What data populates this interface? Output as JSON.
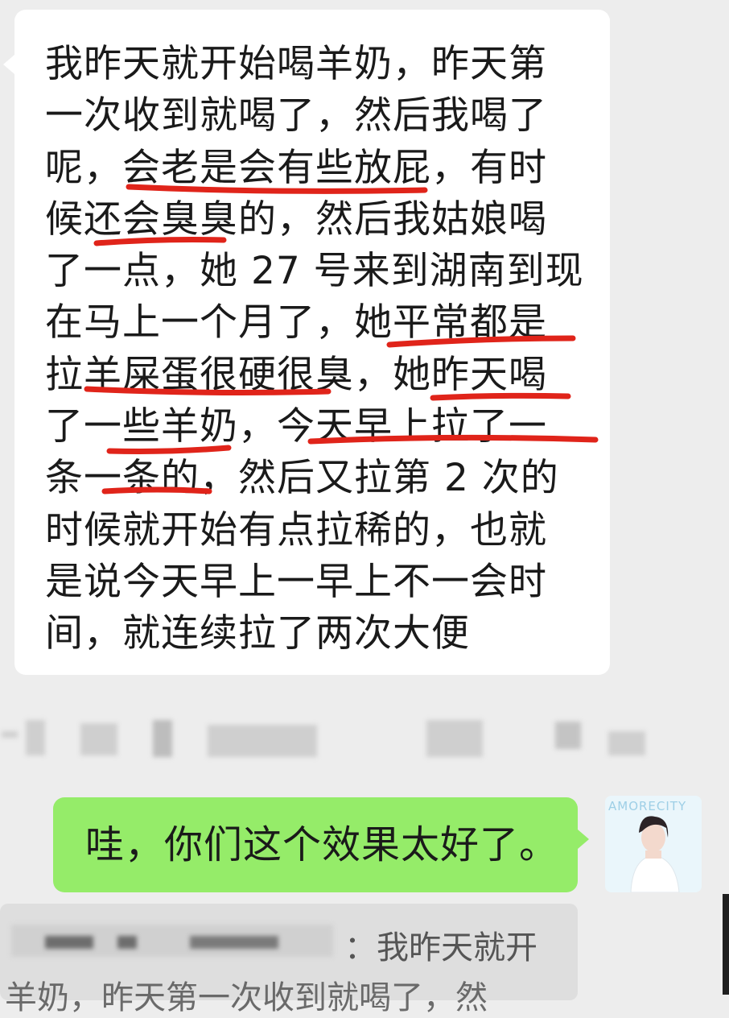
{
  "incoming_message": {
    "text": "我昨天就开始喝羊奶，昨天第一次收到就喝了，然后我喝了呢，会老是会有些放屁，有时候还会臭臭的，然后我姑娘喝了一点，她 27 号来到湖南到现在马上一个月了，她平常都是拉羊屎蛋很硬很臭，她昨天喝了一些羊奶，今天早上拉了一条一条的，然后又拉第 2 次的时候就开始有点拉稀的，也就是说今天早上一早上不一会时间，就连续拉了两次大便"
  },
  "outgoing_message": {
    "text": "哇，你们这个效果太好了。"
  },
  "avatar": {
    "watermark": "AMORECITY"
  },
  "quoted_reply": {
    "prefix": "：我昨天就开",
    "second_line": "羊奶，昨天第一次收到就喝了，然"
  },
  "colors": {
    "chat_bg": "#ededed",
    "incoming_bg": "#ffffff",
    "outgoing_bg": "#95ec69",
    "underline": "#e0241a"
  }
}
